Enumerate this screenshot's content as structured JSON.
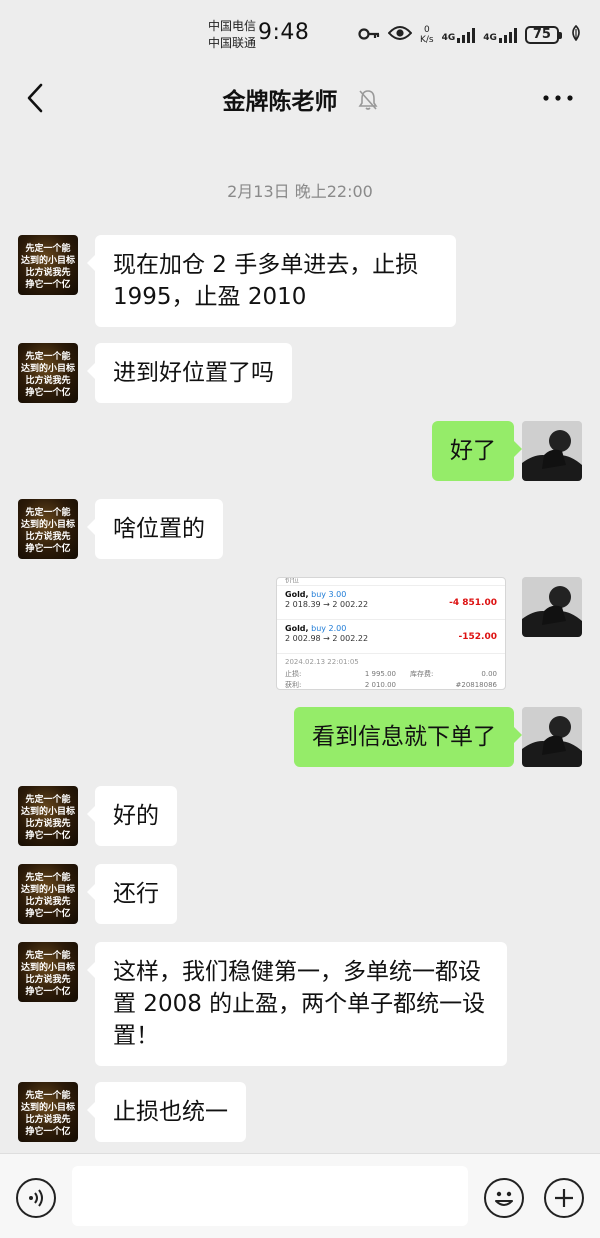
{
  "status_bar": {
    "carrier_1": "中国电信",
    "carrier_2": "中国联通",
    "time": "9:48",
    "net_speed_value": "0",
    "net_speed_unit": "K/s",
    "network_1": "4G",
    "network_2": "4G",
    "battery": "75",
    "icons": [
      "key-icon",
      "eye-icon",
      "signal-icon",
      "battery-icon",
      "leaf-icon"
    ]
  },
  "header": {
    "title": "金牌陈老师",
    "icons": [
      "back-icon",
      "mute-bell-icon",
      "more-icon"
    ]
  },
  "chat": {
    "timestamp": "2月13日 晚上22:00",
    "avatar_teacher_lines": [
      "先定一个能",
      "达到的小目标",
      "比方说我先",
      "挣它一个亿"
    ],
    "messages": [
      {
        "from": "teacher",
        "text": "现在加仓 2 手多单进去，止损 1995，止盈 2010"
      },
      {
        "from": "teacher",
        "text": "进到好位置了吗"
      },
      {
        "from": "me",
        "text": "好了"
      },
      {
        "from": "teacher",
        "text": "啥位置的"
      },
      {
        "from": "me",
        "type": "image"
      },
      {
        "from": "me",
        "text": "看到信息就下单了"
      },
      {
        "from": "teacher",
        "text": "好的"
      },
      {
        "from": "teacher",
        "text": "还行"
      },
      {
        "from": "teacher",
        "text": "这样，我们稳健第一，多单统一都设置 2008 的止盈，两个单子都统一设置！"
      },
      {
        "from": "teacher",
        "text": "止损也统一"
      }
    ]
  },
  "trade_screenshot": {
    "header_label": "价位",
    "trades": [
      {
        "symbol": "Gold,",
        "side": "buy 3.00",
        "prices": "2 018.39 → 2 002.22",
        "pl": "-4 851.00"
      },
      {
        "symbol": "Gold,",
        "side": "buy 2.00",
        "prices": "2 002.98 → 2 002.22",
        "pl": "-152.00"
      }
    ],
    "datetime": "2024.02.13 22:01:05",
    "sl_label": "止损:",
    "sl_value": "1 995.00",
    "swap_label": "库存费:",
    "swap_value": "0.00",
    "tp_label": "获利:",
    "tp_value": "2 010.00",
    "order_id": "#20818086"
  },
  "input_bar": {
    "placeholder": "",
    "icons": [
      "voice-icon",
      "emoji-icon",
      "plus-icon"
    ]
  },
  "colors": {
    "background": "#ededed",
    "bubble_me": "#95ec69",
    "bubble_other": "#ffffff",
    "loss": "#dd1111",
    "buy": "#1e7bd6"
  }
}
